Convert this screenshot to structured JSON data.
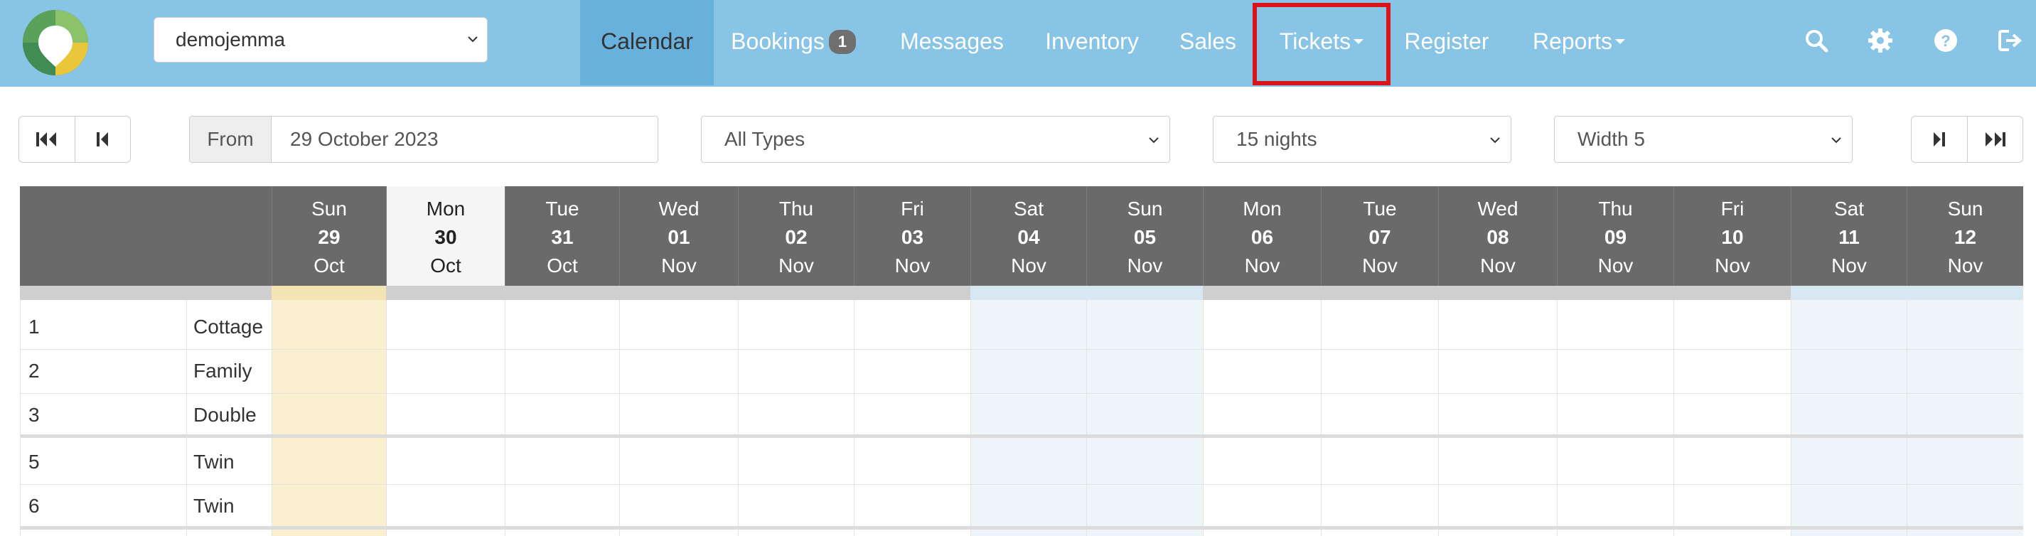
{
  "navbar": {
    "property": "demojemma",
    "items": [
      {
        "label": "Calendar",
        "active": true
      },
      {
        "label": "Bookings",
        "badge": "1"
      },
      {
        "label": "Messages"
      },
      {
        "label": "Inventory"
      },
      {
        "label": "Sales"
      },
      {
        "label": "Tickets",
        "dropdown": true
      },
      {
        "label": "Register"
      },
      {
        "label": "Reports",
        "dropdown": true
      }
    ],
    "icons": [
      "search-icon",
      "gear-icon",
      "help-icon",
      "logout-icon"
    ]
  },
  "toolbar": {
    "from_label": "From",
    "from_value": "29 October 2023",
    "type_select": "All Types",
    "nights_select": "15 nights",
    "width_select": "Width 5"
  },
  "calendar": {
    "days": [
      {
        "dow": "Sun",
        "num": "29",
        "month": "Oct"
      },
      {
        "dow": "Mon",
        "num": "30",
        "month": "Oct"
      },
      {
        "dow": "Tue",
        "num": "31",
        "month": "Oct"
      },
      {
        "dow": "Wed",
        "num": "01",
        "month": "Nov"
      },
      {
        "dow": "Thu",
        "num": "02",
        "month": "Nov"
      },
      {
        "dow": "Fri",
        "num": "03",
        "month": "Nov"
      },
      {
        "dow": "Sat",
        "num": "04",
        "month": "Nov"
      },
      {
        "dow": "Sun",
        "num": "05",
        "month": "Nov"
      },
      {
        "dow": "Mon",
        "num": "06",
        "month": "Nov"
      },
      {
        "dow": "Tue",
        "num": "07",
        "month": "Nov"
      },
      {
        "dow": "Wed",
        "num": "08",
        "month": "Nov"
      },
      {
        "dow": "Thu",
        "num": "09",
        "month": "Nov"
      },
      {
        "dow": "Fri",
        "num": "10",
        "month": "Nov"
      },
      {
        "dow": "Sat",
        "num": "11",
        "month": "Nov"
      },
      {
        "dow": "Sun",
        "num": "12",
        "month": "Nov"
      }
    ],
    "rows": [
      {
        "num": "1",
        "type": "Cottage"
      },
      {
        "num": "2",
        "type": "Family"
      },
      {
        "num": "3",
        "type": "Double"
      },
      {
        "num": "5",
        "type": "Twin"
      },
      {
        "num": "6",
        "type": "Twin"
      }
    ]
  },
  "colors": {
    "navbar": "#87c4e6",
    "nav_active": "#68b1dc",
    "highlight": "#d9141a",
    "header": "#6a6a6a",
    "today_col": "#faf0d0",
    "weekend_col": "#eef5f9"
  }
}
